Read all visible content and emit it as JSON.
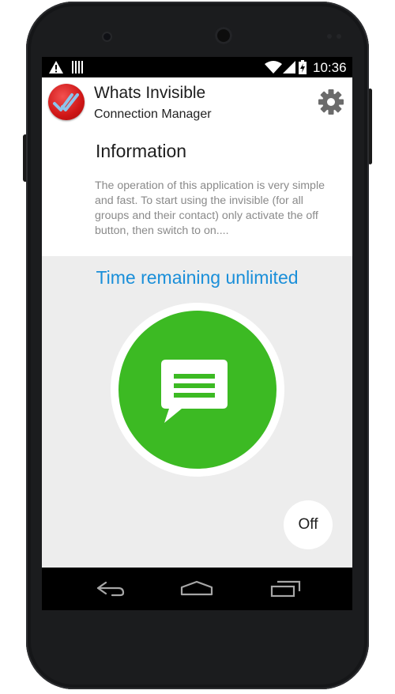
{
  "status_bar": {
    "time": "10:36",
    "left_icons": [
      "warning-icon",
      "barcode-icon"
    ],
    "right_icons": [
      "wifi-icon",
      "signal-icon",
      "battery-charging-icon"
    ]
  },
  "app_bar": {
    "title": "Whats Invisible",
    "subtitle": "Connection Manager",
    "icon": "double-check-icon",
    "settings_icon": "gear-icon"
  },
  "information": {
    "title": "Information",
    "body": "The operation of this application is very simple and fast. To start using the invisible (for all groups and their contact) only activate the off button, then switch to on...."
  },
  "timer": {
    "text": "Time remaining unlimited"
  },
  "main_button": {
    "icon": "chat-message-icon"
  },
  "toggle": {
    "label": "Off"
  },
  "nav_bar": {
    "icons": [
      "back-icon",
      "home-icon",
      "recent-apps-icon"
    ]
  },
  "colors": {
    "accent_green": "#3cba23",
    "timer_blue": "#1a8fd9",
    "app_icon_red": "#d41b1b",
    "background_gray": "#ededed"
  }
}
